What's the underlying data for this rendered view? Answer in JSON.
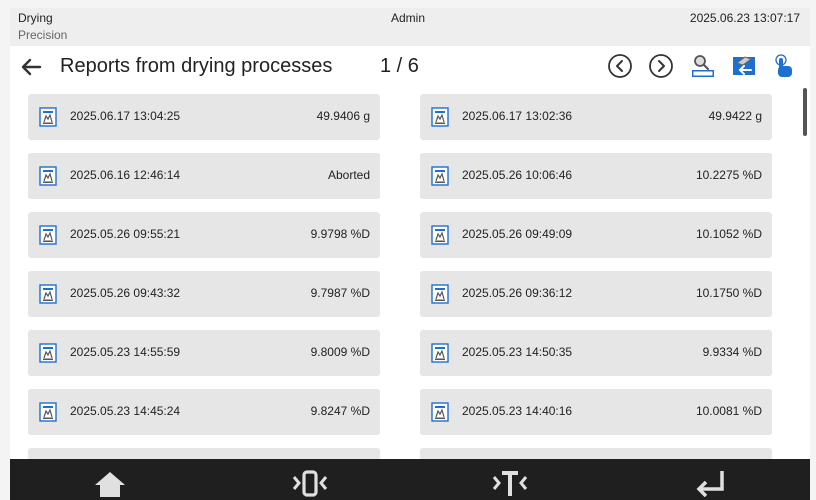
{
  "header": {
    "mode": "Drying",
    "mode_sub": "Precision",
    "user": "Admin",
    "datetime": "2025.06.23 13:07:17"
  },
  "titlebar": {
    "title": "Reports from drying processes",
    "pages": "1 / 6"
  },
  "toolbar": {
    "prev_icon": "circle-chevron-left",
    "next_icon": "circle-chevron-right",
    "date_search_icon": "search-date",
    "export_icon": "usb-export",
    "touch_icon": "hand-pointer"
  },
  "reports": [
    {
      "date": "2025.06.17 13:04:25",
      "value": "49.9406 g"
    },
    {
      "date": "2025.06.17 13:02:36",
      "value": "49.9422 g"
    },
    {
      "date": "2025.06.16 12:46:14",
      "value": "Aborted"
    },
    {
      "date": "2025.05.26 10:06:46",
      "value": "10.2275 %D"
    },
    {
      "date": "2025.05.26 09:55:21",
      "value": "9.9798 %D"
    },
    {
      "date": "2025.05.26 09:49:09",
      "value": "10.1052 %D"
    },
    {
      "date": "2025.05.26 09:43:32",
      "value": "9.7987 %D"
    },
    {
      "date": "2025.05.26 09:36:12",
      "value": "10.1750 %D"
    },
    {
      "date": "2025.05.23 14:55:59",
      "value": "9.8009 %D"
    },
    {
      "date": "2025.05.23 14:50:35",
      "value": "9.9334 %D"
    },
    {
      "date": "2025.05.23 14:45:24",
      "value": "9.8247 %D"
    },
    {
      "date": "2025.05.23 14:40:16",
      "value": "10.0081 %D"
    }
  ],
  "bottombar": {
    "items": [
      "home-icon",
      "zero-icon",
      "tare-icon",
      "enter-icon"
    ]
  },
  "colors": {
    "header_bg": "#eeeeee",
    "card_bg": "#e6e6e6",
    "bottombar_bg": "#1f1f1f",
    "accent": "#1e6fd0"
  }
}
